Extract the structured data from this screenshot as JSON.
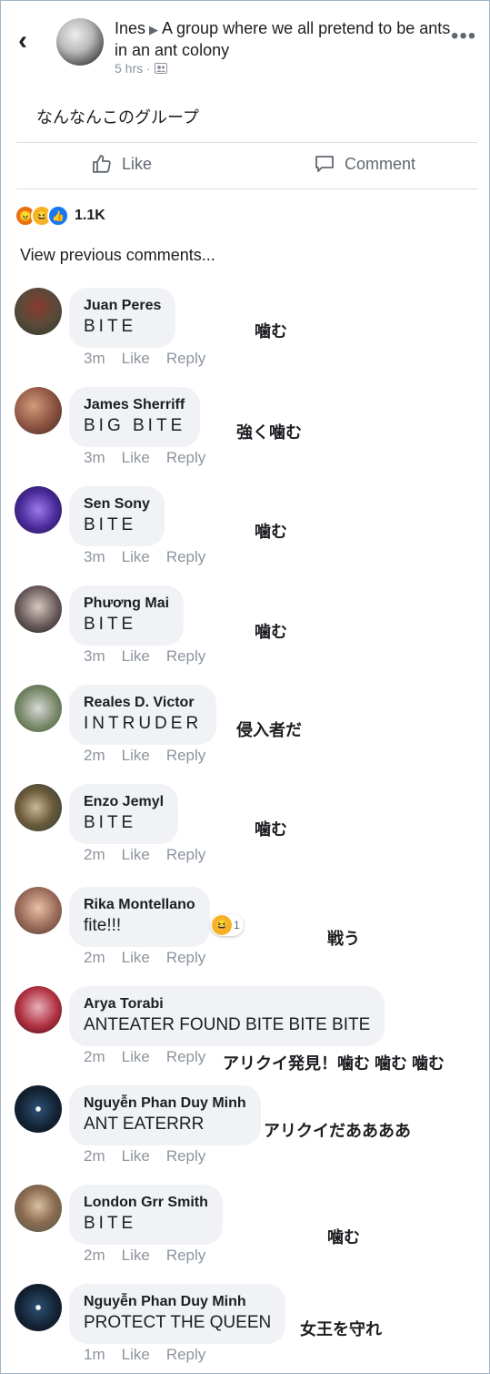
{
  "post": {
    "author": "Ines",
    "group": "A group where we all pretend to be ants in an ant colony",
    "time": "5 hrs",
    "dot": "·",
    "text": "なんなんこのグループ"
  },
  "actions": {
    "like": "Like",
    "comment": "Comment"
  },
  "reactions": {
    "count": "1.1K",
    "types": [
      "angry-icon",
      "haha-icon",
      "like-icon"
    ]
  },
  "view_previous": "View previous comments...",
  "labels": {
    "like": "Like",
    "reply": "Reply"
  },
  "colors": {
    "bubble": "#f0f2f5",
    "meta": "#8d949e",
    "accent": "#1877f2"
  },
  "comments": [
    {
      "name": "Juan Peres",
      "text": "BITE",
      "time": "3m",
      "jp": "噛む"
    },
    {
      "name": "James Sherriff",
      "text": "BIG BITE",
      "time": "3m",
      "jp": "強く噛む"
    },
    {
      "name": "Sen Sony",
      "text": "BITE",
      "time": "3m",
      "jp": "噛む"
    },
    {
      "name": "Phương Mai",
      "text": "BITE",
      "time": "3m",
      "jp": "噛む"
    },
    {
      "name": "Reales D. Victor",
      "text": "INTRUDER",
      "time": "2m",
      "jp": "侵入者だ"
    },
    {
      "name": "Enzo Jemyl",
      "text": "BITE",
      "time": "2m",
      "jp": "噛む"
    },
    {
      "name": "Rika Montellano",
      "text": "fite!!!",
      "time": "2m",
      "jp": "戦う",
      "reaction_count": "1"
    },
    {
      "name": "Arya Torabi",
      "text": "ANTEATER FOUND BITE BITE BITE",
      "time": "2m",
      "jp": "アリクイ発見！噛む 噛む 噛む"
    },
    {
      "name": "Nguyễn Phan Duy Minh",
      "text": "ANT EATERRR",
      "time": "2m",
      "jp": "アリクイだああああ"
    },
    {
      "name": "London Grr Smith",
      "text": "BITE",
      "time": "2m",
      "jp": "噛む"
    },
    {
      "name": "Nguyễn Phan Duy Minh",
      "text": "PROTECT THE QUEEN",
      "time": "1m",
      "jp": "女王を守れ"
    }
  ]
}
